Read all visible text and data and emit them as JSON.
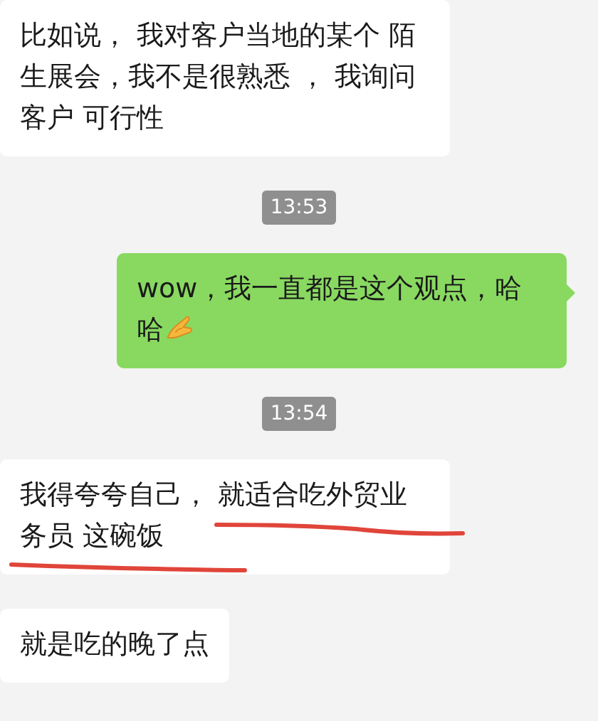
{
  "messages": [
    {
      "kind": "incoming",
      "text": "比如说， 我对客户当地的某个 陌生展会，我不是很熟悉 ， 我询问客户 可行性",
      "underlined": false
    },
    {
      "kind": "time",
      "text": "13:53"
    },
    {
      "kind": "outgoing",
      "text": "wow，我一直都是这个观点，哈哈"
    },
    {
      "kind": "time",
      "text": "13:54"
    },
    {
      "kind": "incoming",
      "text": "我得夸夸自己， 就适合吃外贸业务员 这碗饭",
      "underlined": true
    },
    {
      "kind": "incoming",
      "text": "就是吃的晚了点",
      "underlined": false
    }
  ]
}
